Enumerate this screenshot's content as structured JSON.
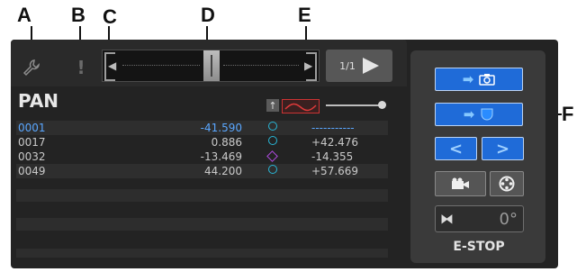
{
  "callouts": [
    "A",
    "B",
    "C",
    "D",
    "E",
    "F"
  ],
  "toolbar": {
    "settings_icon": "wrench-icon",
    "warning_icon": "warning-icon",
    "page_label": "1/1"
  },
  "pan": {
    "title": "PAN",
    "rows": [
      {
        "id": "0001",
        "value": "-41.590",
        "marker": "circle",
        "rel": "-----------",
        "selected": true
      },
      {
        "id": "0017",
        "value": "0.886",
        "marker": "circle",
        "rel": "+42.476",
        "selected": false
      },
      {
        "id": "0032",
        "value": "-13.469",
        "marker": "diamond",
        "rel": "-14.355",
        "selected": false
      },
      {
        "id": "0049",
        "value": "44.200",
        "marker": "circle",
        "rel": "+57.669",
        "selected": false
      }
    ]
  },
  "side": {
    "rotation_value": "0°",
    "estop_label": "E-STOP"
  },
  "colors": {
    "accent_blue": "#1f6bd8",
    "selected_text": "#5aa7ff",
    "marker_circle": "#29b6d6",
    "marker_diamond": "#b04be0"
  }
}
